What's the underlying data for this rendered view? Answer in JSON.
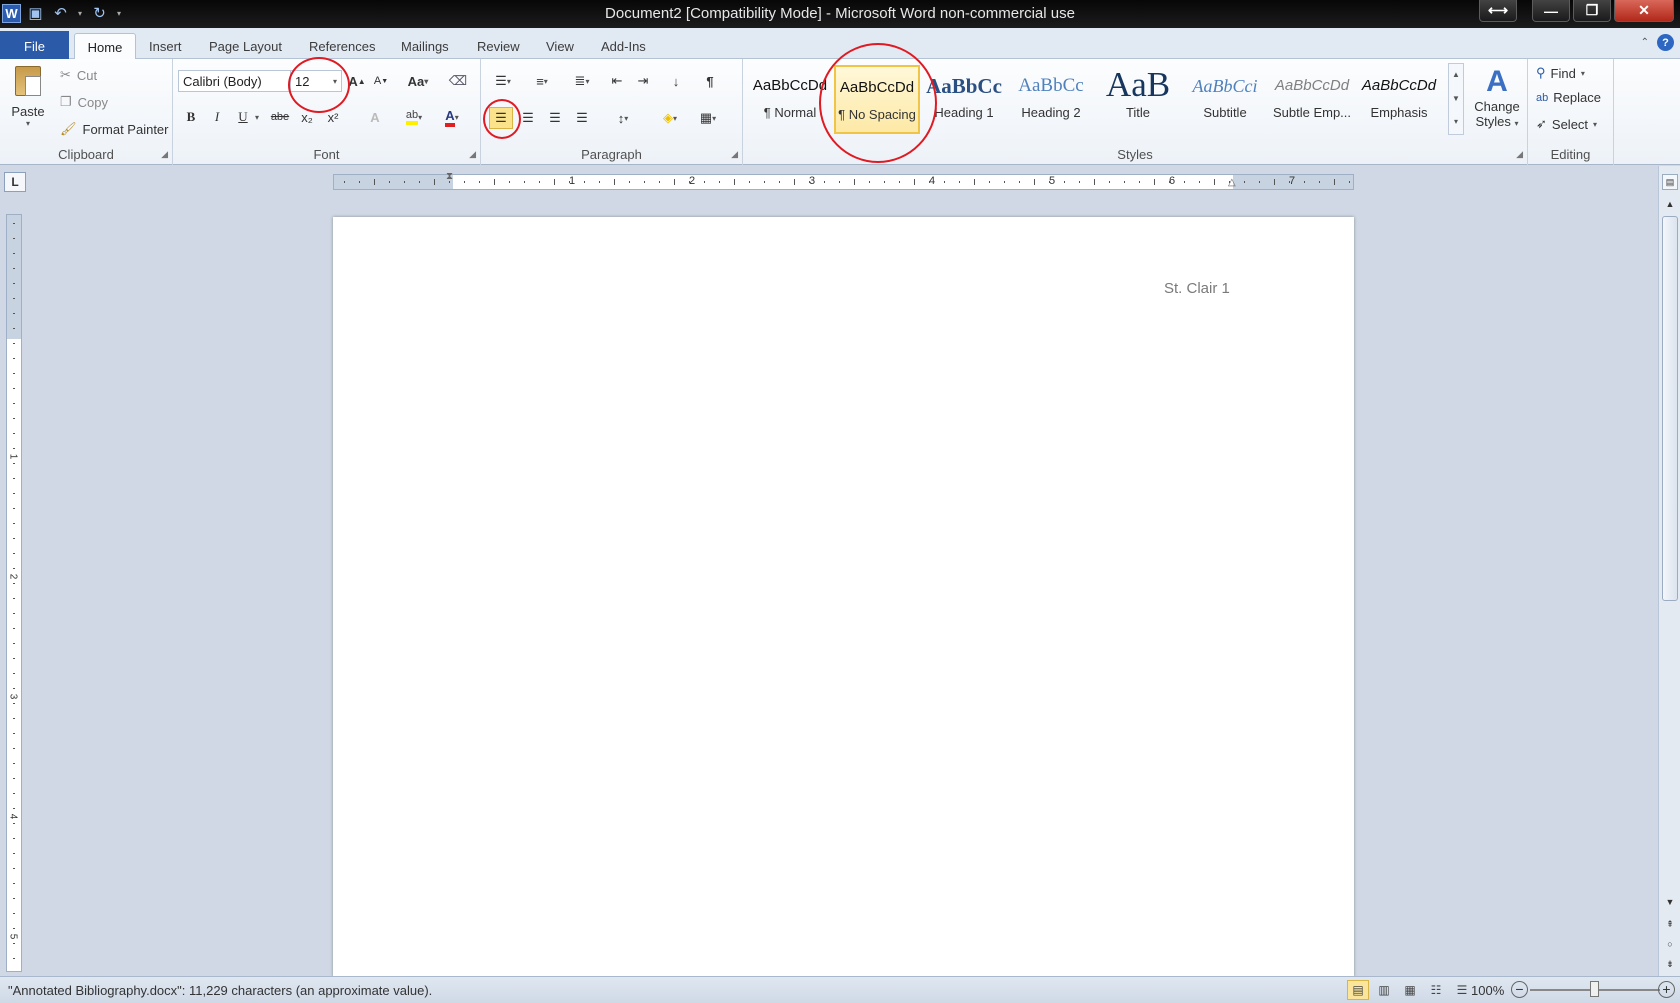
{
  "window": {
    "title": "Document2 [Compatibility Mode]  -  Microsoft Word non-commercial use",
    "app_logo": "W"
  },
  "tabs": {
    "file": "File",
    "home": "Home",
    "insert": "Insert",
    "page_layout": "Page Layout",
    "references": "References",
    "mailings": "Mailings",
    "review": "Review",
    "view": "View",
    "add_ins": "Add-Ins",
    "help": "?"
  },
  "clipboard": {
    "paste": "Paste",
    "cut": "Cut",
    "copy": "Copy",
    "format_painter": "Format Painter",
    "label": "Clipboard"
  },
  "font": {
    "name": "Calibri (Body)",
    "size": "12",
    "grow": "A",
    "shrink": "A",
    "case": "Aa",
    "bold": "B",
    "italic": "I",
    "underline": "U",
    "strike": "abe",
    "sub": "x₂",
    "sup": "x²",
    "label": "Font"
  },
  "paragraph": {
    "pilcrow": "¶",
    "label": "Paragraph"
  },
  "styles": {
    "items": [
      {
        "preview": "AaBbCcDd",
        "name": "¶ Normal"
      },
      {
        "preview": "AaBbCcDd",
        "name": "¶ No Spacing"
      },
      {
        "preview": "AaBbCc",
        "name": "Heading 1"
      },
      {
        "preview": "AaBbCc",
        "name": "Heading 2"
      },
      {
        "preview": "AaB",
        "name": "Title"
      },
      {
        "preview": "AaBbCci",
        "name": "Subtitle"
      },
      {
        "preview": "AaBbCcDd",
        "name": "Subtle Emp..."
      },
      {
        "preview": "AaBbCcDd",
        "name": "Emphasis"
      }
    ],
    "change_styles_1": "Change",
    "change_styles_2": "Styles",
    "label": "Styles"
  },
  "editing": {
    "find": "Find",
    "replace": "Replace",
    "select": "Select",
    "label": "Editing"
  },
  "ruler": {
    "numbers": [
      "1",
      "2",
      "3",
      "4",
      "5",
      "6",
      "7"
    ],
    "vertical_numbers": [
      "1",
      "2",
      "3",
      "4",
      "5"
    ],
    "tab_selector": "L"
  },
  "document": {
    "header_text": "St. Clair 1"
  },
  "status": {
    "text": "\"Annotated Bibliography.docx\": 11,229 characters (an approximate value).",
    "zoom": "100%",
    "zoom_minus": "−",
    "zoom_plus": "+"
  },
  "colors": {
    "file_tab": "#2a5aa8",
    "annotation_red": "#e01a22",
    "selected_highlight": "#f0c447"
  }
}
